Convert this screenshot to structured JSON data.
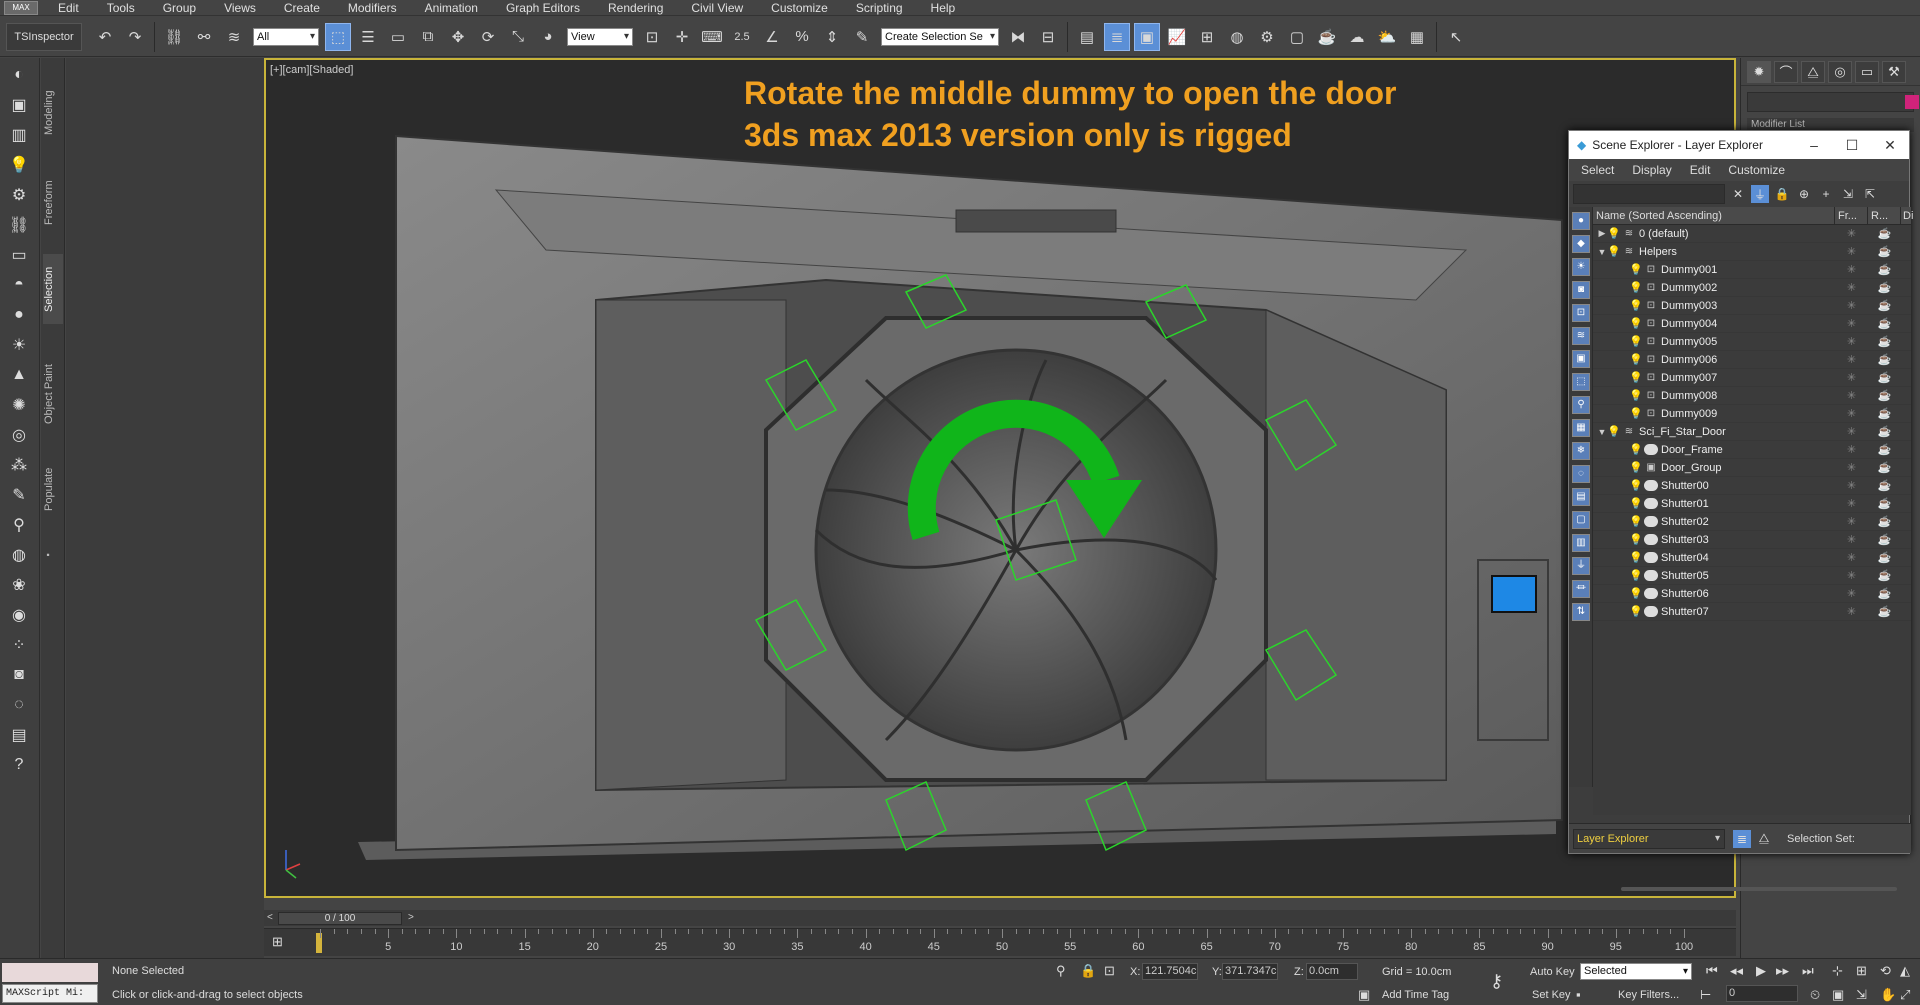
{
  "app": {
    "logo": "MAX"
  },
  "menu": [
    "Edit",
    "Tools",
    "Group",
    "Views",
    "Create",
    "Modifiers",
    "Animation",
    "Graph Editors",
    "Rendering",
    "Civil View",
    "Customize",
    "Scripting",
    "Help"
  ],
  "toolbar": {
    "inspector": "TSInspector",
    "filter": "All",
    "ref_coord": "View",
    "angle_snap": "2.5",
    "selection_set": "Create Selection Se"
  },
  "ribbon_tabs": [
    "Modeling",
    "Freeform",
    "Selection",
    "Object Paint",
    "Populate"
  ],
  "viewport": {
    "label": "[+][cam][Shaded]",
    "annotation_line1": "Rotate the middle dummy to open the door",
    "annotation_line2": "3ds max 2013 version  only is rigged"
  },
  "command_panel": {
    "modifier_list": "Modifier List"
  },
  "explorer": {
    "title": "Scene Explorer - Layer Explorer",
    "menu": [
      "Select",
      "Display",
      "Edit",
      "Customize"
    ],
    "columns": {
      "name": "Name (Sorted Ascending)",
      "frozen": "Fr...",
      "render": "R...",
      "display": "Di"
    },
    "rows": [
      {
        "name": "0 (default)",
        "level": 0,
        "type": "layer",
        "expand": "▶"
      },
      {
        "name": "Helpers",
        "level": 0,
        "type": "layer",
        "expand": "▼"
      },
      {
        "name": "Dummy001",
        "level": 1,
        "type": "helper",
        "expand": ""
      },
      {
        "name": "Dummy002",
        "level": 1,
        "type": "helper",
        "expand": ""
      },
      {
        "name": "Dummy003",
        "level": 1,
        "type": "helper",
        "expand": ""
      },
      {
        "name": "Dummy004",
        "level": 1,
        "type": "helper",
        "expand": ""
      },
      {
        "name": "Dummy005",
        "level": 1,
        "type": "helper",
        "expand": ""
      },
      {
        "name": "Dummy006",
        "level": 1,
        "type": "helper",
        "expand": ""
      },
      {
        "name": "Dummy007",
        "level": 1,
        "type": "helper",
        "expand": ""
      },
      {
        "name": "Dummy008",
        "level": 1,
        "type": "helper",
        "expand": ""
      },
      {
        "name": "Dummy009",
        "level": 1,
        "type": "helper",
        "expand": ""
      },
      {
        "name": "Sci_Fi_Star_Door",
        "level": 0,
        "type": "layer",
        "expand": "▼"
      },
      {
        "name": "Door_Frame",
        "level": 1,
        "type": "object",
        "expand": ""
      },
      {
        "name": "Door_Group",
        "level": 1,
        "type": "group",
        "expand": ""
      },
      {
        "name": "Shutter00",
        "level": 1,
        "type": "object",
        "expand": ""
      },
      {
        "name": "Shutter01",
        "level": 1,
        "type": "object",
        "expand": ""
      },
      {
        "name": "Shutter02",
        "level": 1,
        "type": "object",
        "expand": ""
      },
      {
        "name": "Shutter03",
        "level": 1,
        "type": "object",
        "expand": ""
      },
      {
        "name": "Shutter04",
        "level": 1,
        "type": "object",
        "expand": ""
      },
      {
        "name": "Shutter05",
        "level": 1,
        "type": "object",
        "expand": ""
      },
      {
        "name": "Shutter06",
        "level": 1,
        "type": "object",
        "expand": ""
      },
      {
        "name": "Shutter07",
        "level": 1,
        "type": "object",
        "expand": ""
      }
    ],
    "footer_explorer": "Layer Explorer",
    "footer_selection_set": "Selection Set:"
  },
  "timeline": {
    "frame": "0 / 100",
    "ticks": [
      "5",
      "10",
      "15",
      "20",
      "25",
      "30",
      "35",
      "40",
      "45",
      "50",
      "55",
      "60",
      "65",
      "70",
      "75",
      "80",
      "85",
      "90",
      "95",
      "100"
    ]
  },
  "status": {
    "maxscript": "MAXScript Mi:",
    "selection": "None Selected",
    "prompt": "Click or click-and-drag to select objects",
    "x": "121.7504c",
    "y": "371.7347c",
    "z": "0.0cm",
    "grid": "Grid = 10.0cm",
    "add_time_tag": "Add Time Tag",
    "auto_key": "Auto Key",
    "set_key": "Set Key",
    "selected": "Selected",
    "key_filters": "Key Filters...",
    "frame_value": "0"
  },
  "colors": {
    "accent": "#5b8fd6",
    "annotation": "#f0a020",
    "viewport_border": "#c8b43a",
    "helper_green": "#2bd52b"
  }
}
